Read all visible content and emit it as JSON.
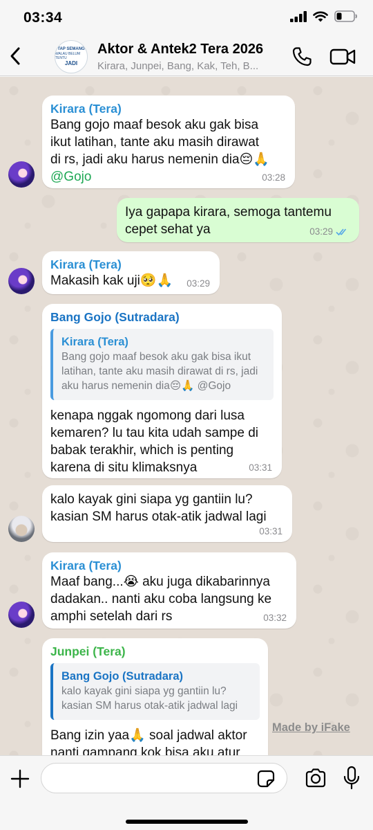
{
  "status": {
    "time": "03:34"
  },
  "header": {
    "avatar_lines": [
      "TAP SEMANG",
      "WALAU BELUM TENTU",
      "JADI"
    ],
    "title": "Aktor & Antek2 Tera 2026",
    "members": "Kirara, Junpei, Bang, Kak, Teh, B..."
  },
  "messages": [
    {
      "sender": "Kirara (Tera)",
      "text": "Bang gojo maaf besok aku gak bisa\nikut latihan, tante aku masih dirawat\ndi rs, jadi aku harus nemenin dia😔🙏",
      "mention": "@Gojo",
      "time": "03:28"
    },
    {
      "text": "Iya gapapa kirara, semoga tantemu\ncepet sehat ya",
      "time": "03:29"
    },
    {
      "sender": "Kirara (Tera)",
      "text": "Makasih kak uji🥺🙏",
      "time": "03:29"
    },
    {
      "sender": "Bang Gojo (Sutradara)",
      "quote_sender": "Kirara (Tera)",
      "quote_text": "Bang gojo maaf besok aku gak bisa ikut\nlatihan, tante aku masih dirawat di rs, jadi\naku harus nemenin dia😔🙏 @Gojo",
      "text": "kenapa nggak ngomong dari lusa\nkemaren? lu tau kita udah sampe di\nbabak terakhir, which is penting\nkarena di situ klimaksnya",
      "time": "03:31"
    },
    {
      "text": "kalo kayak gini siapa yg gantiin lu?\nkasian SM harus otak-atik jadwal lagi",
      "time": "03:31"
    },
    {
      "sender": "Kirara (Tera)",
      "text": "Maaf bang...😭 aku juga dikabarinnya\ndadakan.. nanti aku coba langsung ke\namphi setelah dari rs",
      "time": "03:32"
    },
    {
      "sender": "Junpei (Tera)",
      "quote_sender": "Bang Gojo (Sutradara)",
      "quote_text": "kalo kayak gini siapa yg gantiin lu?\nkasian SM harus otak-atik jadwal lagi",
      "text": "Bang izin yaa🙏 soal jadwal aktor\nnanti gampang kok bisa aku atur"
    }
  ],
  "watermark": "Made by iFake",
  "colors": {
    "kirara": "#2a8fd4",
    "gojo": "#1a74c4",
    "junpei": "#3cb54a",
    "tick": "#53a6e8"
  }
}
